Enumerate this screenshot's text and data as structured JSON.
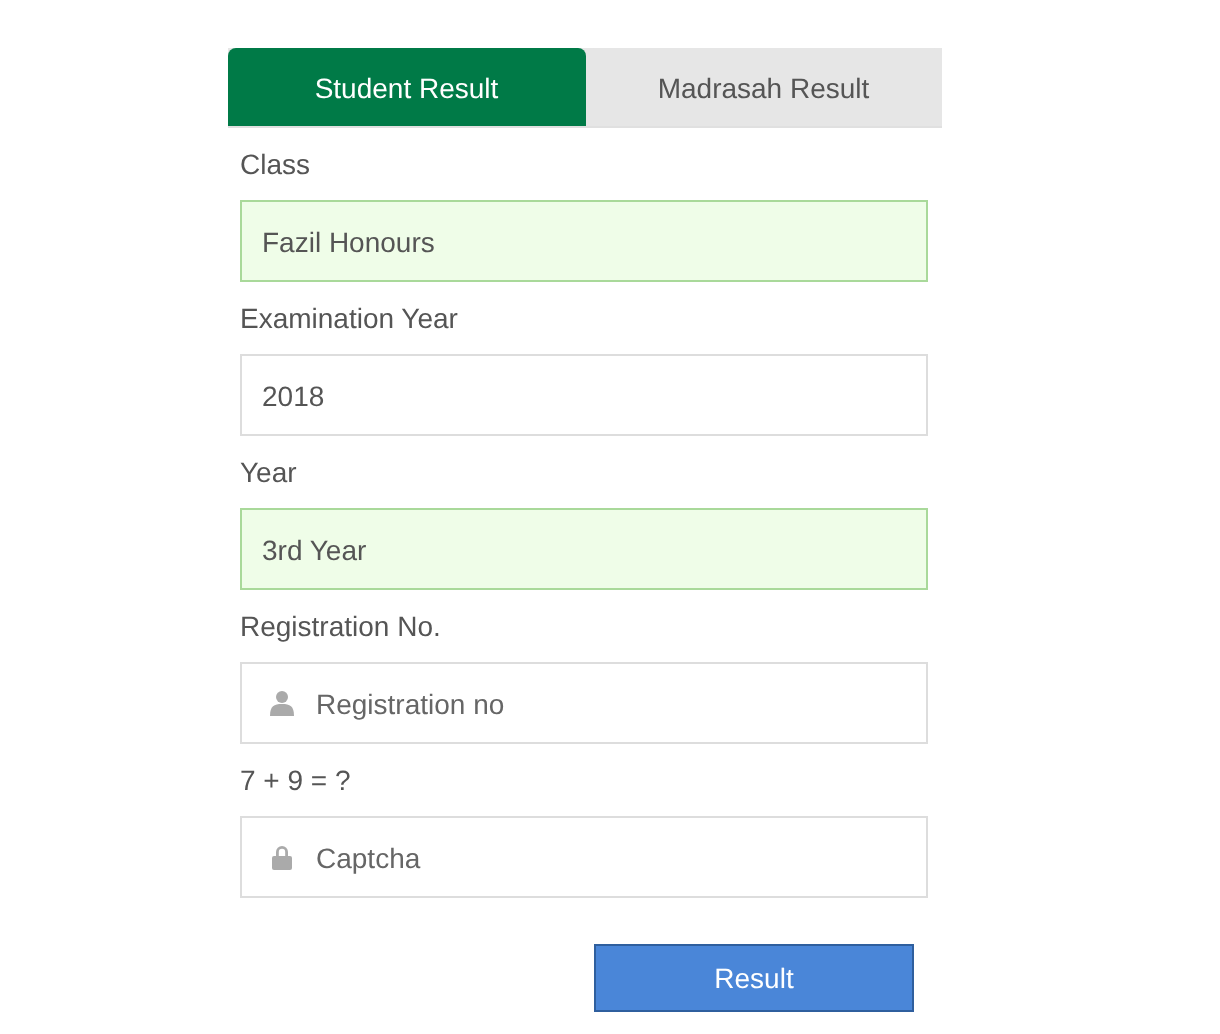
{
  "tabs": [
    {
      "label": "Student Result",
      "selected": true
    },
    {
      "label": "Madrasah Result",
      "selected": false
    }
  ],
  "fields": [
    {
      "label": "Class",
      "value": "Fazil Honours",
      "valid": true
    },
    {
      "label": "Examination Year",
      "value": "2018",
      "valid": false
    },
    {
      "label": "Year",
      "value": "3rd Year",
      "valid": true
    },
    {
      "label": "Registration No.",
      "placeholder": "Registration no",
      "kind": "account",
      "valid": false
    },
    {
      "label": "7 + 9 = ?",
      "placeholder": "Captcha",
      "kind": "captcha",
      "valid": false
    }
  ],
  "submit": "Result"
}
